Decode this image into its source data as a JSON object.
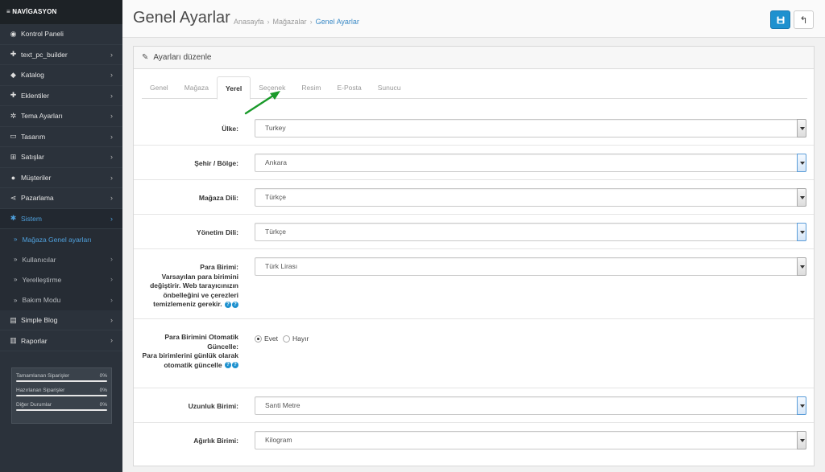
{
  "sidebar": {
    "header": "≡ NAVİGASYON",
    "items": [
      {
        "label": "Kontrol Paneli",
        "icon": "dashboard-icon",
        "glyph": "◉"
      },
      {
        "label": "text_pc_builder",
        "icon": "puzzle-icon",
        "glyph": "✚"
      },
      {
        "label": "Katalog",
        "icon": "tag-icon",
        "glyph": "◆"
      },
      {
        "label": "Eklentiler",
        "icon": "puzzle-icon",
        "glyph": "✚"
      },
      {
        "label": "Tema Ayarları",
        "icon": "cogs-icon",
        "glyph": "✲"
      },
      {
        "label": "Tasarım",
        "icon": "monitor-icon",
        "glyph": "▭"
      },
      {
        "label": "Satışlar",
        "icon": "cart-icon",
        "glyph": "⊞"
      },
      {
        "label": "Müşteriler",
        "icon": "user-icon",
        "glyph": "●"
      },
      {
        "label": "Pazarlama",
        "icon": "share-icon",
        "glyph": "⋖"
      },
      {
        "label": "Sistem",
        "icon": "gear-icon",
        "glyph": "✱"
      }
    ],
    "sub_items": [
      {
        "label": "Mağaza Genel ayarları"
      },
      {
        "label": "Kullanıcılar"
      },
      {
        "label": "Yerelleştirme"
      },
      {
        "label": "Bakım Modu"
      }
    ],
    "items_after": [
      {
        "label": "Simple Blog",
        "icon": "document-icon",
        "glyph": "▤"
      },
      {
        "label": "Raporlar",
        "icon": "bar-chart-icon",
        "glyph": "▥"
      }
    ],
    "stats": [
      {
        "label": "Tamamlanan Siparişler",
        "value": "0%"
      },
      {
        "label": "Hazırlanan Siparişler",
        "value": "0%"
      },
      {
        "label": "Diğer Durumlar",
        "value": "0%"
      }
    ]
  },
  "header": {
    "title": "Genel Ayarlar",
    "breadcrumb": [
      "Anasayfa",
      "Mağazalar",
      "Genel Ayarlar"
    ]
  },
  "panel": {
    "heading": "Ayarları düzenle",
    "tabs": [
      "Genel",
      "Mağaza",
      "Yerel",
      "Seçenek",
      "Resim",
      "E-Posta",
      "Sunucu"
    ],
    "active_tab": "Yerel"
  },
  "form": {
    "country_label": "Ülke:",
    "country_value": "Turkey",
    "region_label": "Şehir / Bölge:",
    "region_value": "Ankara",
    "store_lang_label": "Mağaza Dili:",
    "store_lang_value": "Türkçe",
    "admin_lang_label": "Yönetim Dili:",
    "admin_lang_value": "Türkçe",
    "currency_label": "Para Birimi:",
    "currency_help": "Varsayılan para birimini değiştirir. Web tarayıcınızın önbelleğini ve çerezleri temizlemeniz gerekir.",
    "currency_value": "Türk Lirası",
    "auto_currency_label": "Para Birimini Otomatik Güncelle:",
    "auto_currency_help": "Para birimlerini günlük olarak otomatik güncelle",
    "auto_currency_yes": "Evet",
    "auto_currency_no": "Hayır",
    "length_label": "Uzunluk Birimi:",
    "length_value": "Santi Metre",
    "weight_label": "Ağırlık Birimi:",
    "weight_value": "Kilogram"
  },
  "colors": {
    "sidebar_bg": "#2b323b",
    "accent": "#1e91cf",
    "annotation_arrow": "#1a9a2a"
  }
}
